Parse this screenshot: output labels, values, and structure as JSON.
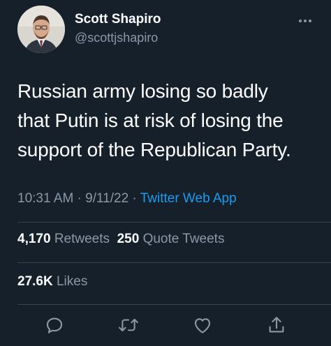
{
  "user": {
    "display_name": "Scott Shapiro",
    "handle": "@scottjshapiro"
  },
  "tweet": {
    "lines": [
      "Russian army losing so badly",
      "that Putin is at risk of losing the",
      "support of the Republican Party."
    ],
    "time": "10:31 AM",
    "separator": " · ",
    "date": "9/11/22",
    "source": "Twitter Web App"
  },
  "stats": {
    "retweets_count": "4,170",
    "retweets_label": "Retweets",
    "quotes_count": "250",
    "quotes_label": "Quote Tweets",
    "likes_count": "27.6K",
    "likes_label": "Likes"
  },
  "icons": {
    "more": "more-icon",
    "reply": "reply-icon",
    "retweet": "retweet-icon",
    "like": "heart-icon",
    "share": "share-icon"
  },
  "colors": {
    "background": "#15202b",
    "secondary_text": "#8b98a5",
    "link": "#1d9bf0",
    "divider": "#38444d"
  }
}
